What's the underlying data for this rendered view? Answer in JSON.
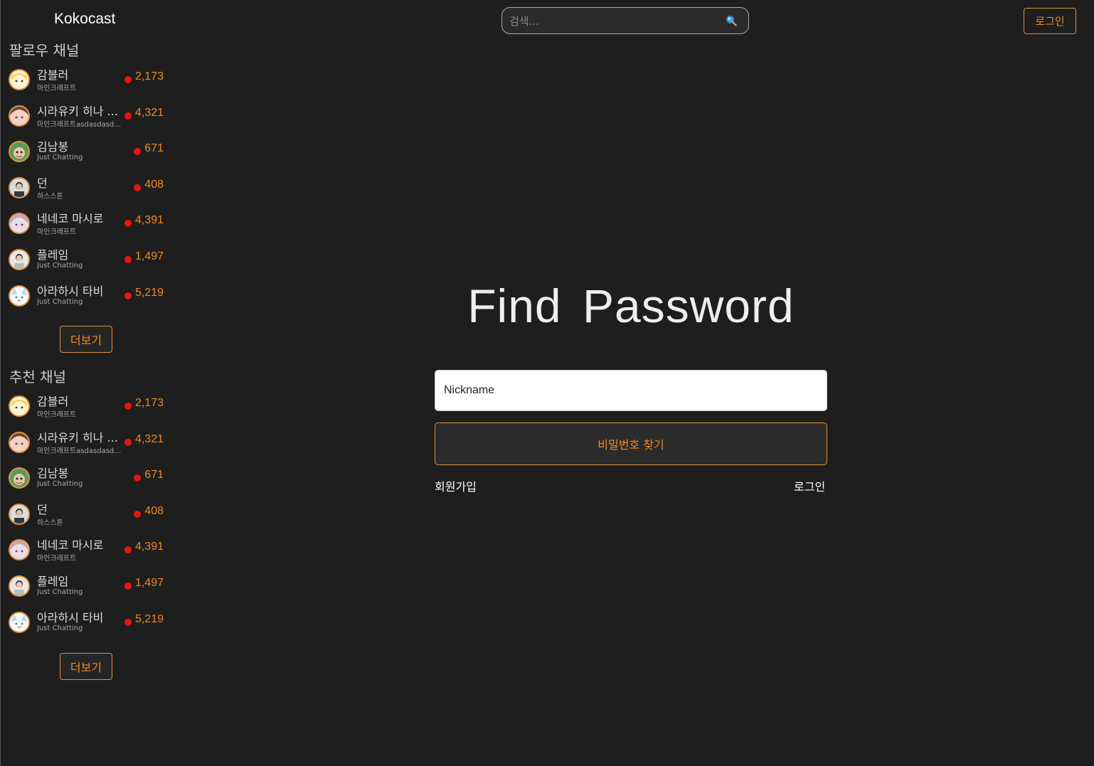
{
  "header": {
    "brand": "Kokocast",
    "search_placeholder": "검색...",
    "login_label": "로그인"
  },
  "sidebar": {
    "follow_title": "팔로우 채널",
    "recommend_title": "추천 채널",
    "more_label": "더보기",
    "follow_channels": [
      {
        "name": "감블러",
        "category": "마인크래프트",
        "viewers": "2,173",
        "avatar": "blonde-anime"
      },
      {
        "name": "시라유키 히나 ...",
        "category": "마인크래프트asdasdasda...",
        "viewers": "4,321",
        "avatar": "brown-hair-anime"
      },
      {
        "name": "김남봉",
        "category": "Just Chatting",
        "viewers": "671",
        "avatar": "green-mascot"
      },
      {
        "name": "던",
        "category": "하스스톤",
        "viewers": "408",
        "avatar": "photo-person"
      },
      {
        "name": "네네코 마시로",
        "category": "마인크래프트",
        "viewers": "4,391",
        "avatar": "pink-hair-anime"
      },
      {
        "name": "플레임",
        "category": "Just Chatting",
        "viewers": "1,497",
        "avatar": "photo-person-2"
      },
      {
        "name": "아라하시 타비",
        "category": "Just Chatting",
        "viewers": "5,219",
        "avatar": "white-cat-anime"
      }
    ],
    "recommend_channels": [
      {
        "name": "감블러",
        "category": "마인크래프트",
        "viewers": "2,173",
        "avatar": "blonde-anime"
      },
      {
        "name": "시라유키 히나 ...",
        "category": "마인크래프트asdasdasda...",
        "viewers": "4,321",
        "avatar": "brown-hair-anime"
      },
      {
        "name": "김남봉",
        "category": "Just Chatting",
        "viewers": "671",
        "avatar": "green-mascot"
      },
      {
        "name": "던",
        "category": "하스스톤",
        "viewers": "408",
        "avatar": "photo-person"
      },
      {
        "name": "네네코 마시로",
        "category": "마인크래프트",
        "viewers": "4,391",
        "avatar": "pink-hair-anime"
      },
      {
        "name": "플레임",
        "category": "Just Chatting",
        "viewers": "1,497",
        "avatar": "photo-person-2"
      },
      {
        "name": "아라하시 타비",
        "category": "Just Chatting",
        "viewers": "5,219",
        "avatar": "white-cat-anime"
      }
    ]
  },
  "main": {
    "title": "Find Password",
    "nickname_placeholder": "Nickname",
    "submit_label": "비밀번호 찾기",
    "signup_link": "회원가입",
    "login_link": "로그인"
  },
  "colors": {
    "background": "#1e1e1e",
    "accent": "#f08a24",
    "live": "#e8140f"
  }
}
